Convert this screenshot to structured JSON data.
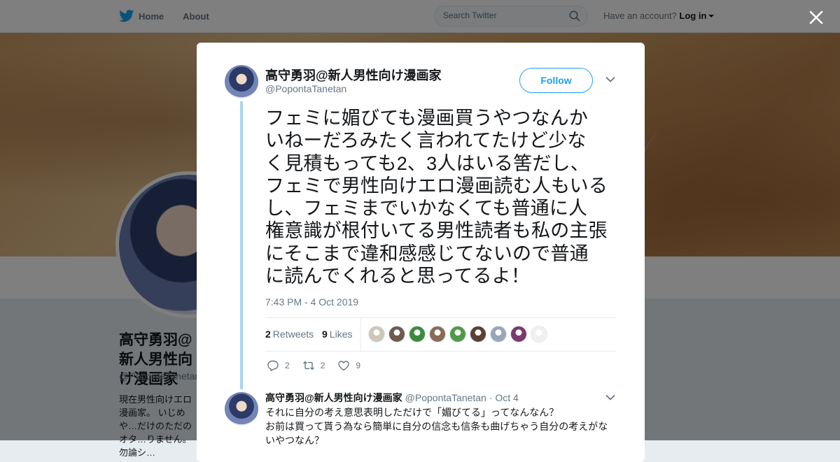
{
  "nav": {
    "home": "Home",
    "about": "About",
    "search_placeholder": "Search Twitter",
    "have_account": "Have an account?",
    "login": "Log in"
  },
  "profile": {
    "name": "高守勇羽@新人男性向け漫画家",
    "handle": "@PopontaTanetan",
    "bio": "現在男性向けエロ漫画家。 いじめや…だけのただのオタ…りません。勿論シ…"
  },
  "tweet": {
    "author_name": "高守勇羽@新人男性向け漫画家",
    "author_handle": "@PopontaTanetan",
    "follow_label": "Follow",
    "text": "フェミに媚びても漫画買うやつなんか\nいねーだろみたく言われてたけど少な\nく見積もっても2、3人はいる筈だし、\nフェミで男性向けエロ漫画読む人もいる\nし、フェミまでいかなくても普通に人\n権意識が根付いてる男性読者も私の主張\nにそこまで違和感感じてないので普通\nに読んでくれると思ってるよ！",
    "timestamp": "7:43 PM - 4 Oct 2019",
    "retweets_count": "2",
    "retweets_label": "Retweets",
    "likes_count": "9",
    "likes_label": "Likes",
    "liker_colors": [
      "#cfc6b8",
      "#6f5a4e",
      "#3d8a3c",
      "#8a6b58",
      "#4f9a46",
      "#5c4034",
      "#9aa5b8",
      "#7a3b6e",
      "#f0f0f0"
    ],
    "actions": {
      "replies": "2",
      "retweets": "2",
      "likes": "9"
    }
  },
  "reply": {
    "author_name": "高守勇羽@新人男性向け漫画家",
    "author_handle": "@PopontaTanetan",
    "separator": "·",
    "date": "Oct 4",
    "text": "それに自分の考え意思表明しただけで「媚びてる」ってなんなん？\nお前は買って貰う為なら簡単に自分の信念も信条も曲げちゃう自分の考えがな\nいやつなん？"
  },
  "colors": {
    "accent": "#1da1f2",
    "thread_line": "#a6d4f2",
    "muted_text": "#657786"
  }
}
